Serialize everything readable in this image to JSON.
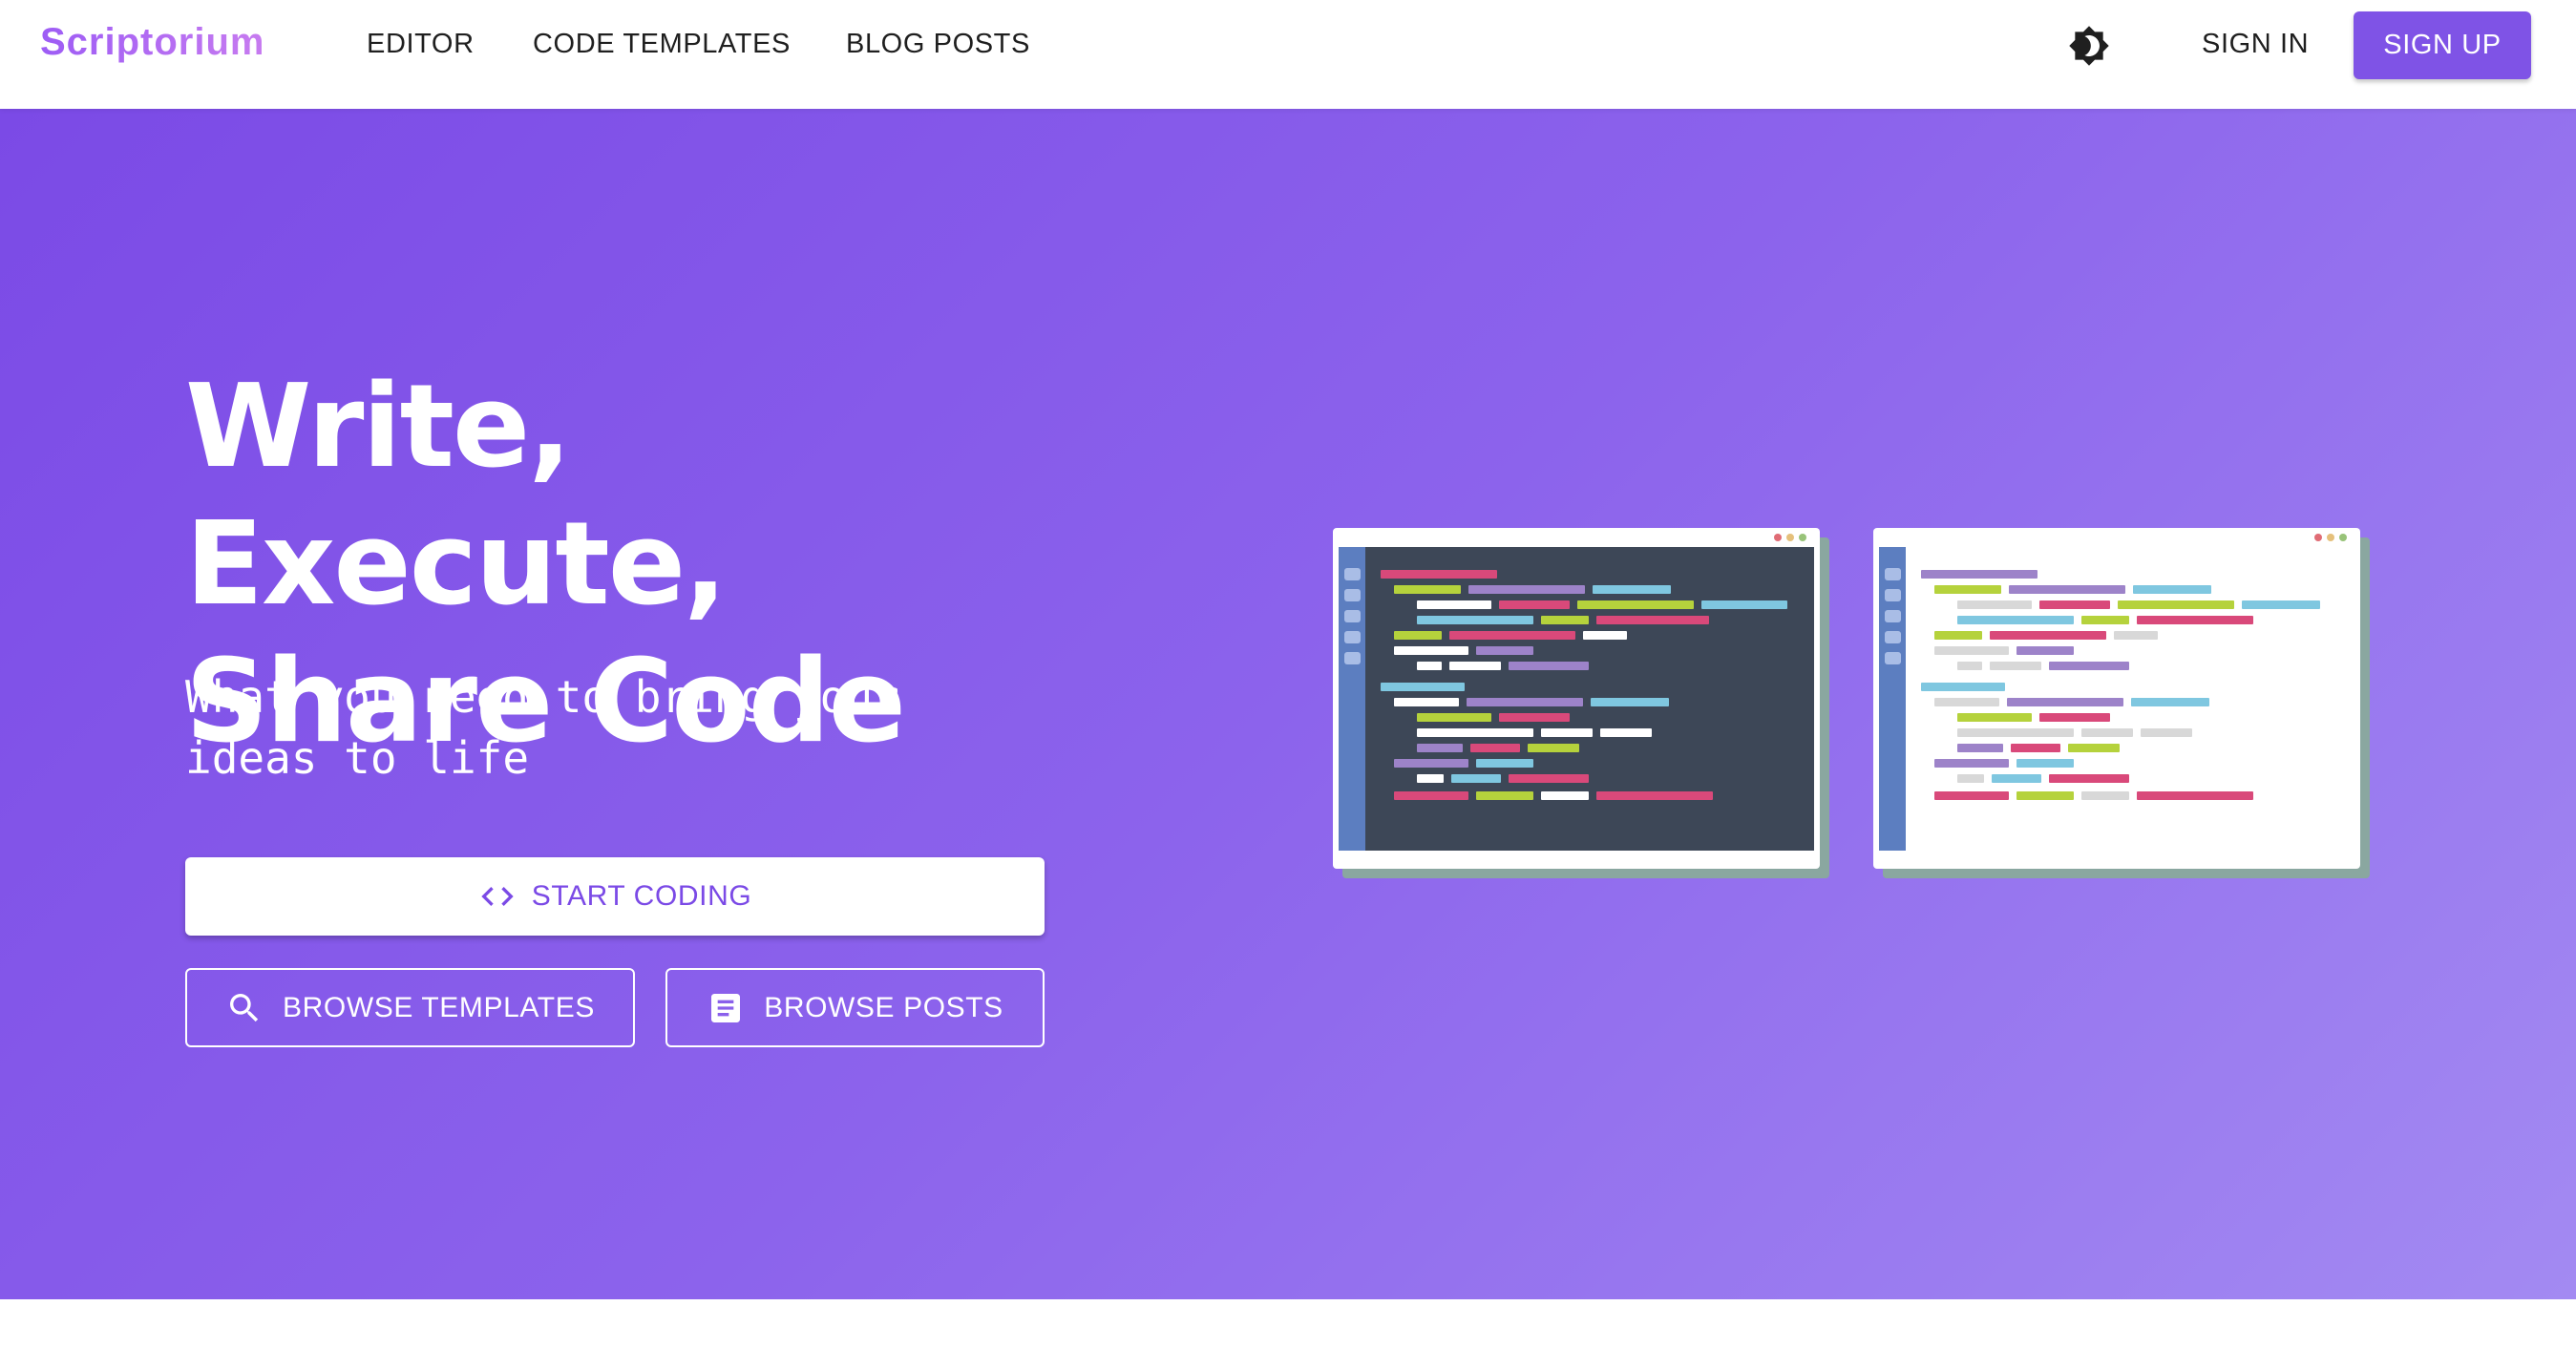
{
  "nav": {
    "brand": "Scriptorium",
    "links": [
      "EDITOR",
      "CODE TEMPLATES",
      "BLOG POSTS"
    ],
    "theme_icon": "brightness-toggle-icon",
    "sign_in": "SIGN IN",
    "sign_up": "SIGN UP"
  },
  "hero": {
    "title_line1": "Write, Execute,",
    "title_line2": "Share Code",
    "subtitle_line1": "What you need to bring your",
    "subtitle_line2": "ideas to life",
    "start_coding": "START CODING",
    "browse_templates": "BROWSE TEMPLATES",
    "browse_posts": "BROWSE POSTS"
  },
  "colors": {
    "accent": "#7f53e6",
    "hero_gradient_start": "#7b4ae6",
    "hero_gradient_end": "#a38af2",
    "code_pink": "#d9497a",
    "code_green": "#b5d23c",
    "code_blue": "#7fc7e0",
    "code_purple": "#9d83c9",
    "code_white": "#ffffff",
    "code_gray": "#d8d8d8"
  }
}
